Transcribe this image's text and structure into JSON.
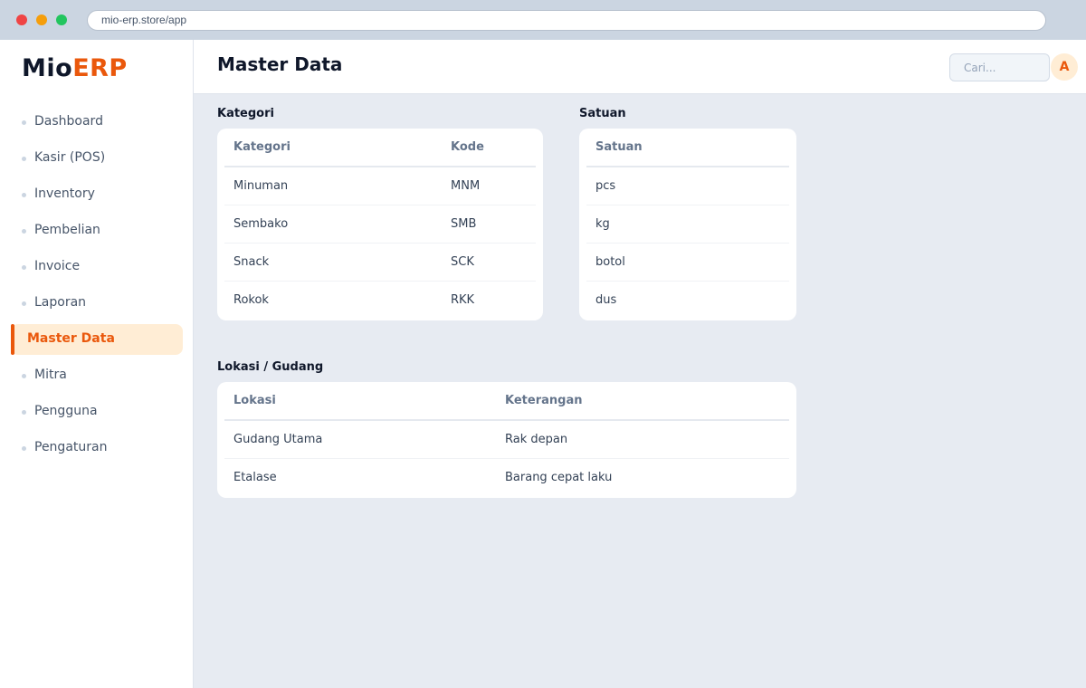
{
  "browser": {
    "url": "mio-erp.store/app",
    "dots": [
      "#ef4444",
      "#f59e0b",
      "#22c55e"
    ]
  },
  "sidebar": {
    "logo_mio": "Mio",
    "logo_erp": "ERP",
    "items": [
      {
        "label": "Dashboard"
      },
      {
        "label": "Kasir (POS)"
      },
      {
        "label": "Inventory"
      },
      {
        "label": "Pembelian"
      },
      {
        "label": "Invoice"
      },
      {
        "label": "Laporan"
      },
      {
        "label": "Master Data",
        "active": true
      },
      {
        "label": "Mitra"
      },
      {
        "label": "Pengguna"
      },
      {
        "label": "Pengaturan"
      }
    ]
  },
  "header": {
    "title": "Master Data",
    "search_placeholder": "Cari...",
    "avatar_initial": "A"
  },
  "kategori": {
    "title": "Kategori",
    "columns": [
      "Kategori",
      "Kode"
    ],
    "rows": [
      [
        "Minuman",
        "MNM"
      ],
      [
        "Sembako",
        "SMB"
      ],
      [
        "Snack",
        "SCK"
      ],
      [
        "Rokok",
        "RKK"
      ]
    ]
  },
  "satuan": {
    "title": "Satuan",
    "columns": [
      "Satuan"
    ],
    "rows": [
      [
        "pcs"
      ],
      [
        "kg"
      ],
      [
        "botol"
      ],
      [
        "dus"
      ]
    ]
  },
  "lokasi": {
    "title": "Lokasi / Gudang",
    "columns": [
      "Lokasi",
      "Keterangan"
    ],
    "rows": [
      [
        "Gudang Utama",
        "Rak depan"
      ],
      [
        "Etalase",
        "Barang cepat laku"
      ]
    ]
  },
  "colors": {
    "accent": "#ea580c",
    "accent_soft": "#ffedd5",
    "background": "#e7ebf2"
  }
}
